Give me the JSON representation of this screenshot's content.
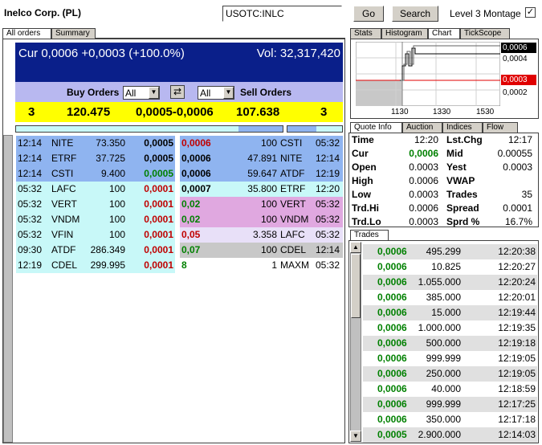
{
  "header": {
    "company": "Inelco Corp. (PL)",
    "symbol_value": "USOTC:INLC",
    "go_label": "Go",
    "search_label": "Search",
    "level3_label": "Level 3 Montage",
    "level3_checked": "✓"
  },
  "left_tabs": [
    "All orders",
    "Summary"
  ],
  "right_tabs": [
    "Stats",
    "Histogram",
    "Chart",
    "TickScope"
  ],
  "banner": {
    "cur": "Cur 0,0006 +0,0003 (+100.0%)",
    "vol": "Vol: 32,317,420"
  },
  "filter": {
    "buy_label": "Buy Orders",
    "buy_select": "All",
    "sell_select": "All",
    "sell_label": "Sell Orders",
    "swap_icon": "⇄"
  },
  "summary_bar": {
    "buy_count": "3",
    "buy_volume": "120.475",
    "spread": "0,0005-0,0006",
    "sell_volume": "107.638",
    "sell_count": "3"
  },
  "buy_rows": [
    {
      "time": "12:14",
      "mm": "NITE",
      "size": "73.350",
      "price": "0,0005",
      "pcolor": "bold"
    },
    {
      "time": "12:14",
      "mm": "ETRF",
      "size": "37.725",
      "price": "0,0005",
      "pcolor": "bold"
    },
    {
      "time": "12:14",
      "mm": "CSTI",
      "size": "9.400",
      "price": "0,0005",
      "pcolor": "green"
    },
    {
      "time": "05:32",
      "mm": "LAFC",
      "size": "100",
      "price": "0,0001",
      "pcolor": "red"
    },
    {
      "time": "05:32",
      "mm": "VERT",
      "size": "100",
      "price": "0,0001",
      "pcolor": "red"
    },
    {
      "time": "05:32",
      "mm": "VNDM",
      "size": "100",
      "price": "0,0001",
      "pcolor": "red"
    },
    {
      "time": "05:32",
      "mm": "VFIN",
      "size": "100",
      "price": "0,0001",
      "pcolor": "red"
    },
    {
      "time": "09:30",
      "mm": "ATDF",
      "size": "286.349",
      "price": "0,0001",
      "pcolor": "red"
    },
    {
      "time": "12:19",
      "mm": "CDEL",
      "size": "299.995",
      "price": "0,0001",
      "pcolor": "red"
    }
  ],
  "sell_rows": [
    {
      "price": "0,0006",
      "size": "100",
      "mm": "CSTI",
      "time": "05:32",
      "pcolor": "red"
    },
    {
      "price": "0,0006",
      "size": "47.891",
      "mm": "NITE",
      "time": "12:14",
      "pcolor": "bold"
    },
    {
      "price": "0,0006",
      "size": "59.647",
      "mm": "ATDF",
      "time": "12:19",
      "pcolor": "bold"
    },
    {
      "price": "0,0007",
      "size": "35.800",
      "mm": "ETRF",
      "time": "12:20",
      "pcolor": "bold"
    },
    {
      "price": "0,02",
      "size": "100",
      "mm": "VERT",
      "time": "05:32",
      "pcolor": "green"
    },
    {
      "price": "0,02",
      "size": "100",
      "mm": "VNDM",
      "time": "05:32",
      "pcolor": "green"
    },
    {
      "price": "0,05",
      "size": "3.358",
      "mm": "LAFC",
      "time": "05:32",
      "pcolor": "red"
    },
    {
      "price": "0,07",
      "size": "100",
      "mm": "CDEL",
      "time": "12:14",
      "pcolor": "green"
    },
    {
      "price": "8",
      "size": "1",
      "mm": "MAXM",
      "time": "05:32",
      "pcolor": "green"
    }
  ],
  "mini_chart": {
    "price_labels": [
      "0,0006",
      "0,0004",
      "0,0003",
      "0,0002"
    ],
    "time_labels": [
      "1130",
      "1330",
      "1530"
    ]
  },
  "quote_tabs": [
    "Quote Info",
    "Auction",
    "Indices",
    "Flow"
  ],
  "quote": [
    {
      "l": "Time",
      "lv": "12:20",
      "r": "Lst.Chg",
      "rv": "12:17",
      "lvc": ""
    },
    {
      "l": "Cur",
      "lv": "0,0006",
      "r": "Mid",
      "rv": "0.00055",
      "lvc": "green"
    },
    {
      "l": "Open",
      "lv": "0.0003",
      "r": "Yest",
      "rv": "0.0003",
      "lvc": ""
    },
    {
      "l": "High",
      "lv": "0.0006",
      "r": "VWAP",
      "rv": "",
      "lvc": ""
    },
    {
      "l": "Low",
      "lv": "0.0003",
      "r": "Trades",
      "rv": "35",
      "lvc": ""
    },
    {
      "l": "Trd.Hi",
      "lv": "0.0006",
      "r": "Spread",
      "rv": "0.0001",
      "lvc": ""
    },
    {
      "l": "Trd.Lo",
      "lv": "0.0003",
      "r": "Sprd %",
      "rv": "16.7%",
      "lvc": ""
    }
  ],
  "trades_tab": "Trades",
  "trades": [
    {
      "price": "0,0006",
      "size": "495.299",
      "time": "12:20:38"
    },
    {
      "price": "0,0006",
      "size": "10.825",
      "time": "12:20:27"
    },
    {
      "price": "0,0006",
      "size": "1.055.000",
      "time": "12:20:24"
    },
    {
      "price": "0,0006",
      "size": "385.000",
      "time": "12:20:01"
    },
    {
      "price": "0,0006",
      "size": "15.000",
      "time": "12:19:44"
    },
    {
      "price": "0,0006",
      "size": "1.000.000",
      "time": "12:19:35"
    },
    {
      "price": "0,0006",
      "size": "500.000",
      "time": "12:19:18"
    },
    {
      "price": "0,0006",
      "size": "999.999",
      "time": "12:19:05"
    },
    {
      "price": "0,0006",
      "size": "250.000",
      "time": "12:19:05"
    },
    {
      "price": "0,0006",
      "size": "40.000",
      "time": "12:18:59"
    },
    {
      "price": "0,0006",
      "size": "999.999",
      "time": "12:17:25"
    },
    {
      "price": "0,0006",
      "size": "350.000",
      "time": "12:17:18"
    },
    {
      "price": "0,0005",
      "size": "2.900.000",
      "time": "12:14:03"
    }
  ],
  "colors": {
    "banner_bg": "#0a1f8a",
    "filter_bg": "#b8b8f0",
    "summary_bg": "#ffff00",
    "level_blue": "#8fb4f0",
    "level_cyan": "#c8f8f8",
    "level_pink": "#e0a8e0",
    "level_lavender": "#e8e0f8",
    "level_gray": "#c8c8c8"
  }
}
